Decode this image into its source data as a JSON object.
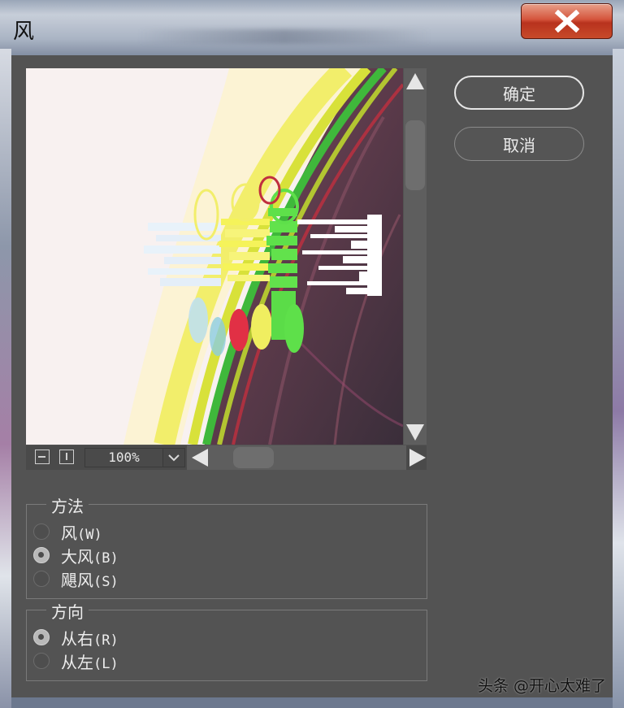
{
  "window": {
    "title": "风",
    "close_icon": "close-icon",
    "close_color": "#c74a2a"
  },
  "buttons": {
    "ok_label": "确定",
    "cancel_label": "取消"
  },
  "preview": {
    "zoom_value": "100%",
    "zoom_out_icon": "minus-icon",
    "zoom_in_icon": "plus-icon",
    "dropdown_icon": "chevron-down-icon"
  },
  "method_group": {
    "legend": "方法",
    "options": [
      {
        "label": "风",
        "key": "(W)",
        "selected": false
      },
      {
        "label": "大风",
        "key": "(B)",
        "selected": true
      },
      {
        "label": "飓风",
        "key": "(S)",
        "selected": false
      }
    ]
  },
  "direction_group": {
    "legend": "方向",
    "options": [
      {
        "label": "从右",
        "key": "(R)",
        "selected": true
      },
      {
        "label": "从左",
        "key": "(L)",
        "selected": false
      }
    ]
  },
  "watermark": "头条 @开心太难了",
  "colors": {
    "dialog_bg": "#535353",
    "text": "#ededed"
  }
}
